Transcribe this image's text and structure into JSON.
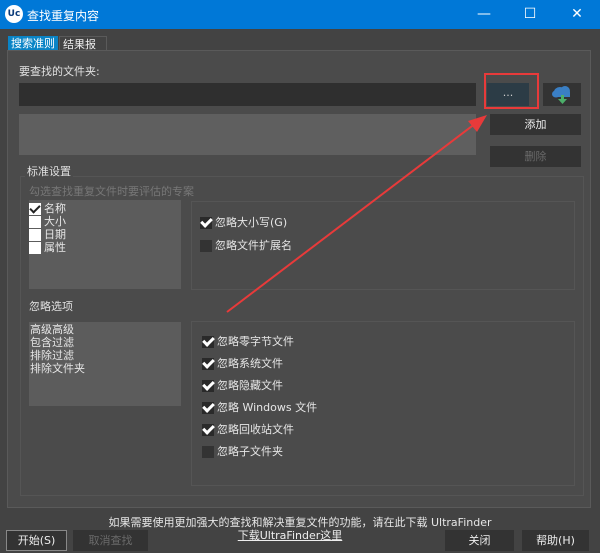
{
  "window": {
    "title": "查找重复内容",
    "icon_text": "Uc",
    "minimize": "—",
    "maximize": "☐",
    "close": "✕"
  },
  "tabs": [
    {
      "label": "搜索准则",
      "active": true
    },
    {
      "label": "结果报告",
      "active": false
    }
  ],
  "folder": {
    "label": "要查找的文件夹:",
    "value": "",
    "browse_label": "...",
    "add_label": "添加",
    "delete_label": "删除"
  },
  "standard": {
    "title": "标准设置",
    "subtitle": "勾选查找重复文件时要评估的专案",
    "criteria": [
      {
        "label": "名称",
        "checked": true
      },
      {
        "label": "大小",
        "checked": false
      },
      {
        "label": "日期",
        "checked": false
      },
      {
        "label": "属性",
        "checked": false
      }
    ],
    "options": [
      {
        "label": "忽略大小写(G)",
        "checked": true
      },
      {
        "label": "忽略文件扩展名",
        "checked": false
      }
    ]
  },
  "ignore": {
    "title": "忽略选项",
    "list": [
      "高级高级",
      "包含过滤",
      "排除过滤",
      "排除文件夹"
    ],
    "options": [
      {
        "label": "忽略零字节文件",
        "checked": true
      },
      {
        "label": "忽略系统文件",
        "checked": true
      },
      {
        "label": "忽略隐藏文件",
        "checked": true
      },
      {
        "label": "忽略 Windows 文件",
        "checked": true
      },
      {
        "label": "忽略回收站文件",
        "checked": true
      },
      {
        "label": "忽略子文件夹",
        "checked": false
      }
    ]
  },
  "footer": {
    "text": "如果需要使用更加强大的查找和解决重复文件的功能，请在此下载 UltraFinder",
    "link": "下载UltraFinder这里"
  },
  "buttons": {
    "start": "开始(S)",
    "cancel": "取消查找",
    "close": "关闭",
    "help": "帮助(H)"
  },
  "colors": {
    "titlebar": "#0078d7",
    "annotation": "#e83a3a"
  }
}
